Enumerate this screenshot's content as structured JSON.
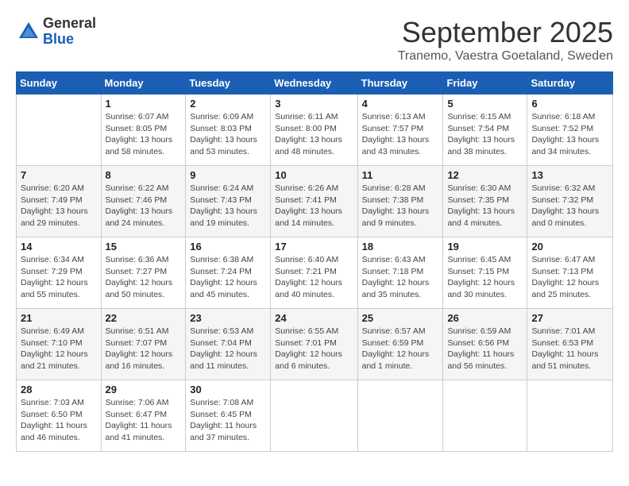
{
  "header": {
    "logo_general": "General",
    "logo_blue": "Blue",
    "month_title": "September 2025",
    "location": "Tranemo, Vaestra Goetaland, Sweden"
  },
  "calendar": {
    "days_of_week": [
      "Sunday",
      "Monday",
      "Tuesday",
      "Wednesday",
      "Thursday",
      "Friday",
      "Saturday"
    ],
    "weeks": [
      [
        {
          "day": "",
          "info": ""
        },
        {
          "day": "1",
          "info": "Sunrise: 6:07 AM\nSunset: 8:05 PM\nDaylight: 13 hours\nand 58 minutes."
        },
        {
          "day": "2",
          "info": "Sunrise: 6:09 AM\nSunset: 8:03 PM\nDaylight: 13 hours\nand 53 minutes."
        },
        {
          "day": "3",
          "info": "Sunrise: 6:11 AM\nSunset: 8:00 PM\nDaylight: 13 hours\nand 48 minutes."
        },
        {
          "day": "4",
          "info": "Sunrise: 6:13 AM\nSunset: 7:57 PM\nDaylight: 13 hours\nand 43 minutes."
        },
        {
          "day": "5",
          "info": "Sunrise: 6:15 AM\nSunset: 7:54 PM\nDaylight: 13 hours\nand 38 minutes."
        },
        {
          "day": "6",
          "info": "Sunrise: 6:18 AM\nSunset: 7:52 PM\nDaylight: 13 hours\nand 34 minutes."
        }
      ],
      [
        {
          "day": "7",
          "info": "Sunrise: 6:20 AM\nSunset: 7:49 PM\nDaylight: 13 hours\nand 29 minutes."
        },
        {
          "day": "8",
          "info": "Sunrise: 6:22 AM\nSunset: 7:46 PM\nDaylight: 13 hours\nand 24 minutes."
        },
        {
          "day": "9",
          "info": "Sunrise: 6:24 AM\nSunset: 7:43 PM\nDaylight: 13 hours\nand 19 minutes."
        },
        {
          "day": "10",
          "info": "Sunrise: 6:26 AM\nSunset: 7:41 PM\nDaylight: 13 hours\nand 14 minutes."
        },
        {
          "day": "11",
          "info": "Sunrise: 6:28 AM\nSunset: 7:38 PM\nDaylight: 13 hours\nand 9 minutes."
        },
        {
          "day": "12",
          "info": "Sunrise: 6:30 AM\nSunset: 7:35 PM\nDaylight: 13 hours\nand 4 minutes."
        },
        {
          "day": "13",
          "info": "Sunrise: 6:32 AM\nSunset: 7:32 PM\nDaylight: 13 hours\nand 0 minutes."
        }
      ],
      [
        {
          "day": "14",
          "info": "Sunrise: 6:34 AM\nSunset: 7:29 PM\nDaylight: 12 hours\nand 55 minutes."
        },
        {
          "day": "15",
          "info": "Sunrise: 6:36 AM\nSunset: 7:27 PM\nDaylight: 12 hours\nand 50 minutes."
        },
        {
          "day": "16",
          "info": "Sunrise: 6:38 AM\nSunset: 7:24 PM\nDaylight: 12 hours\nand 45 minutes."
        },
        {
          "day": "17",
          "info": "Sunrise: 6:40 AM\nSunset: 7:21 PM\nDaylight: 12 hours\nand 40 minutes."
        },
        {
          "day": "18",
          "info": "Sunrise: 6:43 AM\nSunset: 7:18 PM\nDaylight: 12 hours\nand 35 minutes."
        },
        {
          "day": "19",
          "info": "Sunrise: 6:45 AM\nSunset: 7:15 PM\nDaylight: 12 hours\nand 30 minutes."
        },
        {
          "day": "20",
          "info": "Sunrise: 6:47 AM\nSunset: 7:13 PM\nDaylight: 12 hours\nand 25 minutes."
        }
      ],
      [
        {
          "day": "21",
          "info": "Sunrise: 6:49 AM\nSunset: 7:10 PM\nDaylight: 12 hours\nand 21 minutes."
        },
        {
          "day": "22",
          "info": "Sunrise: 6:51 AM\nSunset: 7:07 PM\nDaylight: 12 hours\nand 16 minutes."
        },
        {
          "day": "23",
          "info": "Sunrise: 6:53 AM\nSunset: 7:04 PM\nDaylight: 12 hours\nand 11 minutes."
        },
        {
          "day": "24",
          "info": "Sunrise: 6:55 AM\nSunset: 7:01 PM\nDaylight: 12 hours\nand 6 minutes."
        },
        {
          "day": "25",
          "info": "Sunrise: 6:57 AM\nSunset: 6:59 PM\nDaylight: 12 hours\nand 1 minute."
        },
        {
          "day": "26",
          "info": "Sunrise: 6:59 AM\nSunset: 6:56 PM\nDaylight: 11 hours\nand 56 minutes."
        },
        {
          "day": "27",
          "info": "Sunrise: 7:01 AM\nSunset: 6:53 PM\nDaylight: 11 hours\nand 51 minutes."
        }
      ],
      [
        {
          "day": "28",
          "info": "Sunrise: 7:03 AM\nSunset: 6:50 PM\nDaylight: 11 hours\nand 46 minutes."
        },
        {
          "day": "29",
          "info": "Sunrise: 7:06 AM\nSunset: 6:47 PM\nDaylight: 11 hours\nand 41 minutes."
        },
        {
          "day": "30",
          "info": "Sunrise: 7:08 AM\nSunset: 6:45 PM\nDaylight: 11 hours\nand 37 minutes."
        },
        {
          "day": "",
          "info": ""
        },
        {
          "day": "",
          "info": ""
        },
        {
          "day": "",
          "info": ""
        },
        {
          "day": "",
          "info": ""
        }
      ]
    ]
  }
}
